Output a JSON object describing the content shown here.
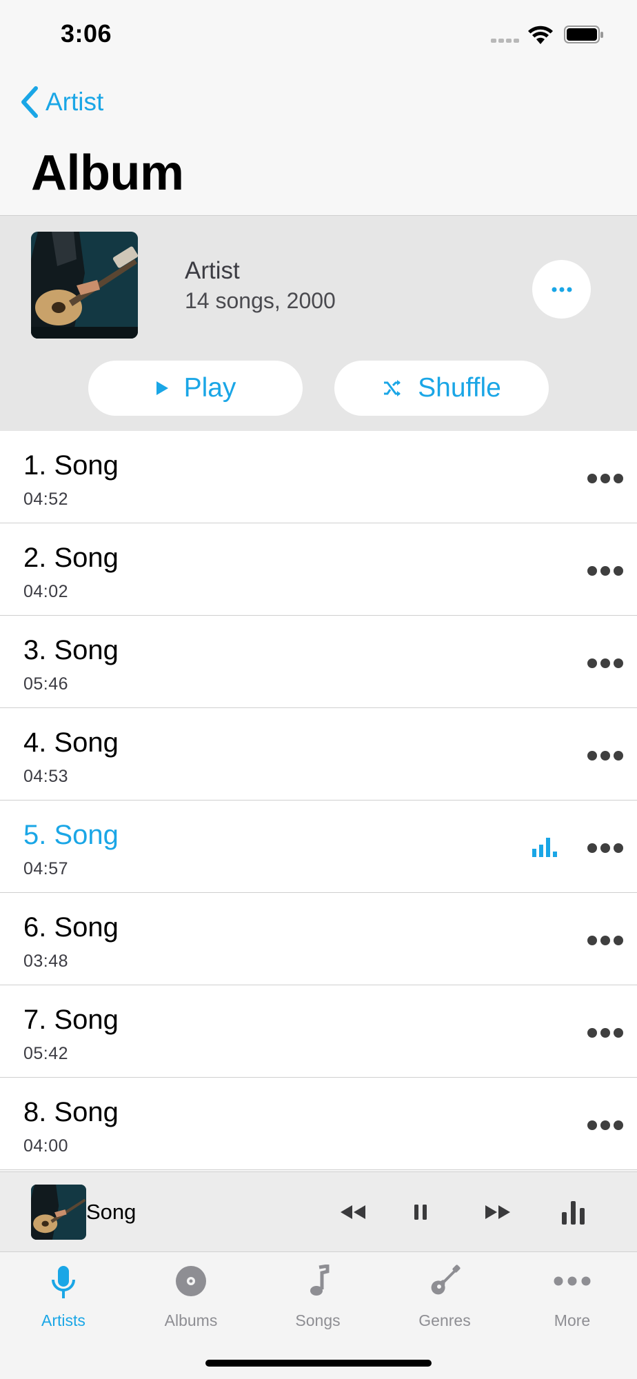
{
  "status_bar": {
    "time": "3:06"
  },
  "nav": {
    "back_label": "Artist",
    "title": "Album"
  },
  "album": {
    "artist": "Artist",
    "meta": "14 songs, 2000",
    "play_label": "Play",
    "shuffle_label": "Shuffle"
  },
  "songs": [
    {
      "title": "1. Song",
      "duration": "04:52"
    },
    {
      "title": "2. Song",
      "duration": "04:02"
    },
    {
      "title": "3. Song",
      "duration": "05:46"
    },
    {
      "title": "4. Song",
      "duration": "04:53"
    },
    {
      "title": "5. Song",
      "duration": "04:57",
      "playing": true
    },
    {
      "title": "6. Song",
      "duration": "03:48"
    },
    {
      "title": "7. Song",
      "duration": "05:42"
    },
    {
      "title": "8. Song",
      "duration": "04:00"
    }
  ],
  "mini_player": {
    "title": "Song"
  },
  "tabs": [
    {
      "label": "Artists",
      "icon": "microphone-icon",
      "active": true
    },
    {
      "label": "Albums",
      "icon": "disc-icon"
    },
    {
      "label": "Songs",
      "icon": "music-note-icon"
    },
    {
      "label": "Genres",
      "icon": "guitar-icon"
    },
    {
      "label": "More",
      "icon": "more-icon"
    }
  ],
  "colors": {
    "accent": "#1aa6e6",
    "header_bg": "#e6e6e6",
    "tab_inactive": "#8e8e93"
  }
}
